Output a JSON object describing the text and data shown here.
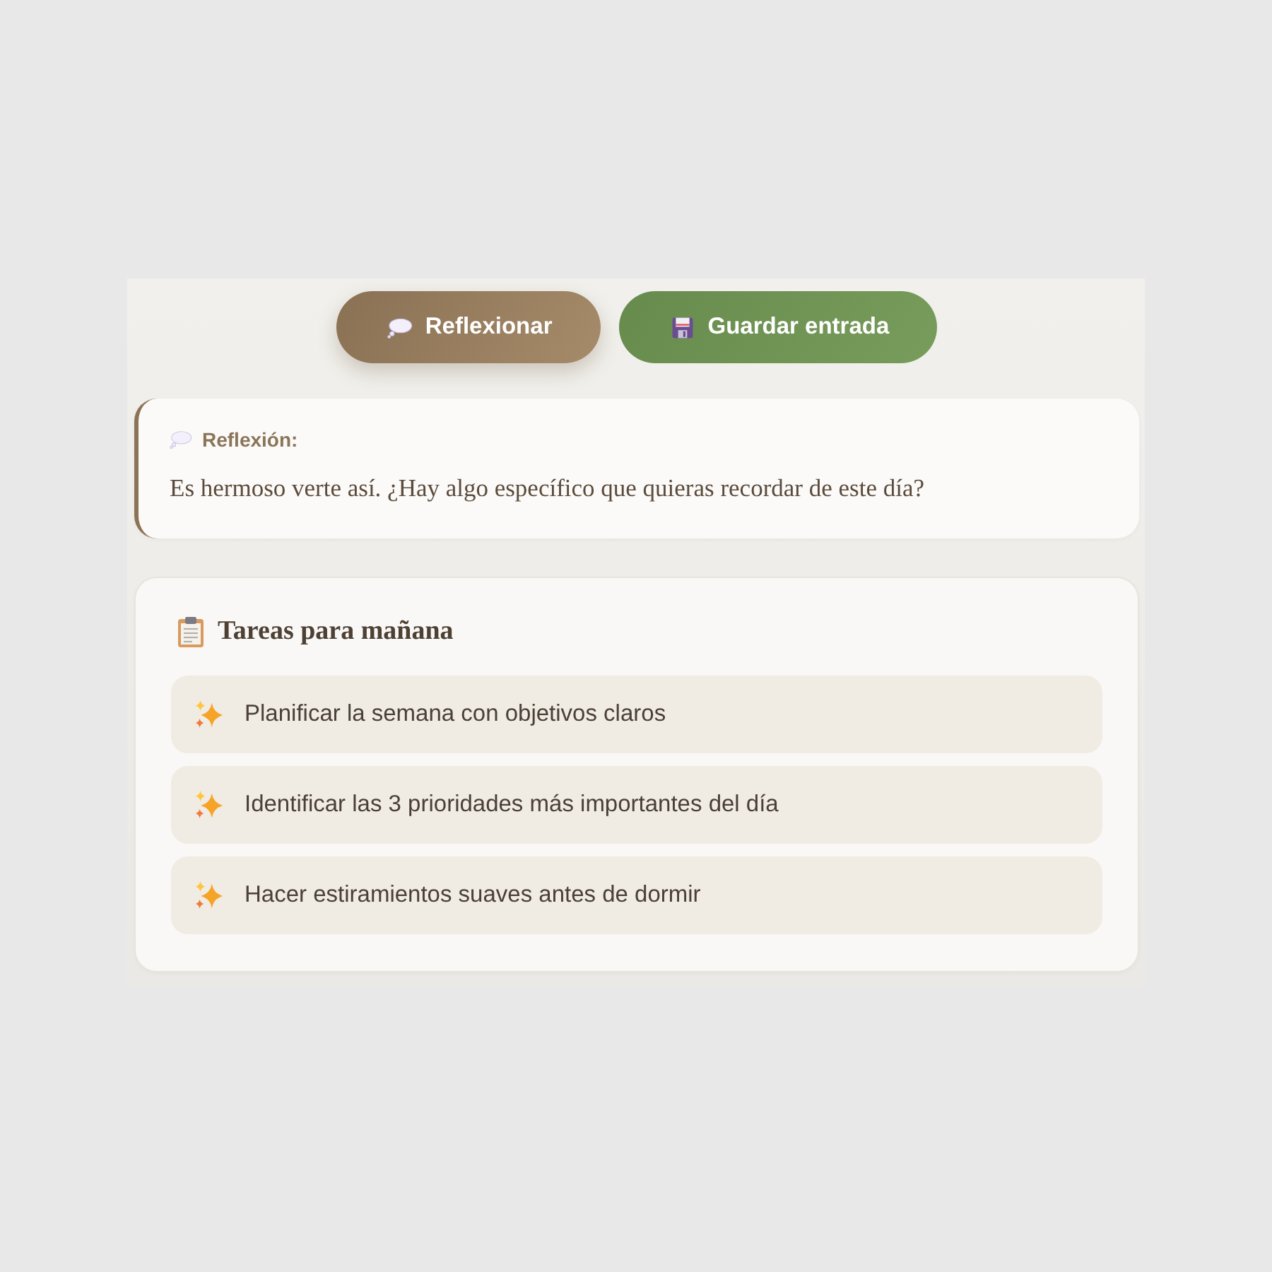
{
  "toolbar": {
    "buttons": [
      {
        "label": "Reflexionar",
        "kind": "reflect"
      },
      {
        "label": "Guardar entrada",
        "kind": "save"
      }
    ]
  },
  "reflection": {
    "label": "Reflexión:",
    "text": "Es hermoso verte así. ¿Hay algo específico que quieras recordar de este día?"
  },
  "tasks": {
    "title": "Tareas para mañana",
    "items": [
      "Planificar la semana con objetivos claros",
      "Identificar las 3 prioridades más importantes del día",
      "Hacer estiramientos suaves antes de dormir"
    ]
  }
}
